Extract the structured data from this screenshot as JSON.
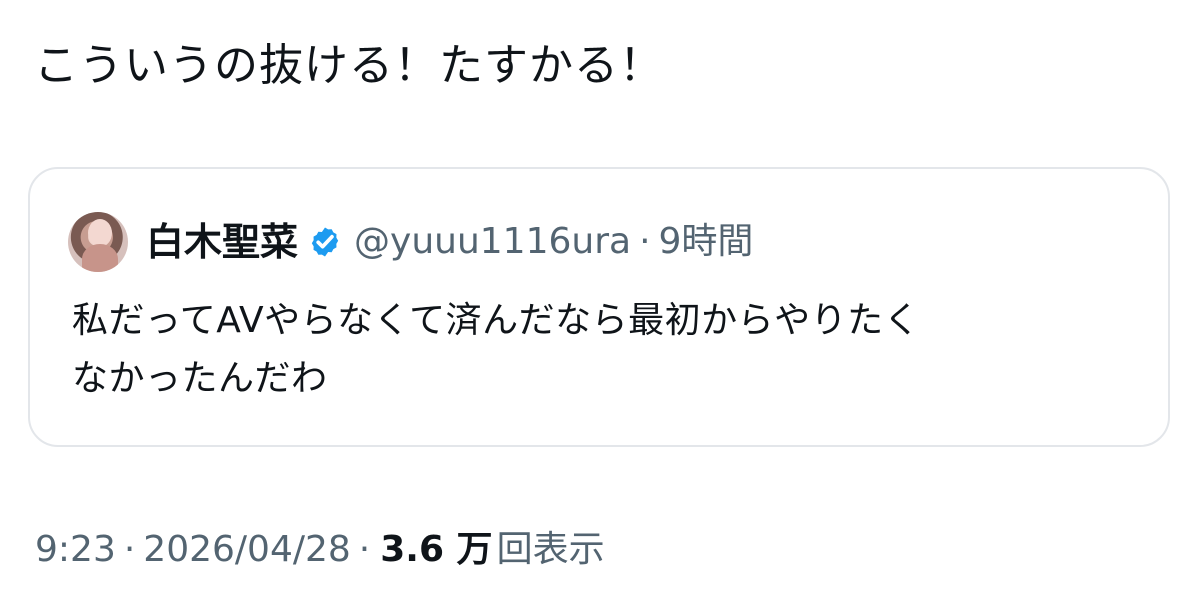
{
  "post": {
    "text": "こういうの抜ける！たすかる！"
  },
  "quoted_post": {
    "author_name": "白木聖菜",
    "handle": "@yuuu1116ura",
    "separator": "·",
    "age": "9時間",
    "text": "私だってAVやらなくて済んだなら最初からやりたく\nなかったんだわ",
    "icons": {
      "avatar": "profile-avatar",
      "verified": "verified-badge-icon"
    }
  },
  "post_meta": {
    "time": "9:23",
    "separator_1": "·",
    "date": "2026/04/28",
    "separator_2": "·",
    "view_count": "3.6 万",
    "view_label": "回表示"
  },
  "colors": {
    "primary_text": "#0f1419",
    "secondary_text": "#536471",
    "card_border": "#e3e6ea",
    "verified_blue": "#1d9bf0"
  }
}
